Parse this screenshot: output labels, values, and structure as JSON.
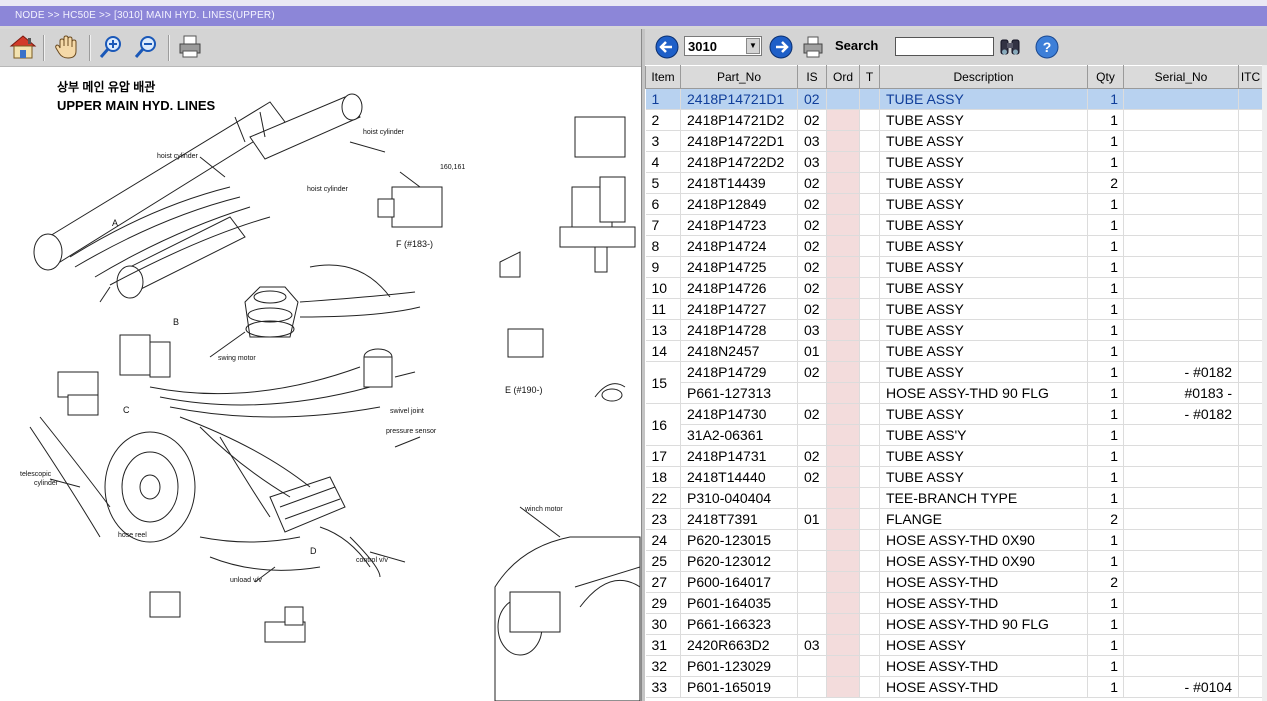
{
  "breadcrumb": "NODE >> HC50E >> [3010] MAIN HYD. LINES(UPPER)",
  "left_toolbar": {
    "icons": [
      "home-icon",
      "hand-icon",
      "zoom-in-icon",
      "zoom-out-icon",
      "print-icon"
    ]
  },
  "diagram": {
    "title_ko": "상부 메인 유압 배관",
    "title_en": "UPPER MAIN HYD. LINES",
    "labels": {
      "hoist_cyl_1": "hoist cylinder",
      "hoist_cyl_2": "hoist cylinder",
      "hoist_cyl_3": "hoist cylinder",
      "swing_motor": "swing motor",
      "swivel_joint": "swivel joint",
      "pressure_sensor": "pressure sensor",
      "telescopic": "telescopic",
      "cylinder": "cylinder",
      "hose_reel": "hose reel",
      "control_vv": "control v/v",
      "unload_vv": "unload v/v",
      "winch_motor": "winch motor",
      "f_detail": "F (#183-)",
      "e_detail": "E (#190-)",
      "f_num": "160,161",
      "a": "A",
      "b": "B",
      "c": "C",
      "d": "D"
    }
  },
  "right_toolbar": {
    "part_no": "3010",
    "search_label": "Search",
    "search_value": ""
  },
  "columns": [
    "Item",
    "Part_No",
    "IS",
    "Ord",
    "T",
    "Description",
    "Qty",
    "Serial_No",
    "ITC"
  ],
  "rows": [
    {
      "item": "1",
      "part": "2418P14721D1",
      "is": "02",
      "desc": "TUBE ASSY",
      "qty": "1",
      "serial": "",
      "sel": true
    },
    {
      "item": "2",
      "part": "2418P14721D2",
      "is": "02",
      "desc": "TUBE ASSY",
      "qty": "1",
      "serial": ""
    },
    {
      "item": "3",
      "part": "2418P14722D1",
      "is": "03",
      "desc": "TUBE ASSY",
      "qty": "1",
      "serial": ""
    },
    {
      "item": "4",
      "part": "2418P14722D2",
      "is": "03",
      "desc": "TUBE ASSY",
      "qty": "1",
      "serial": ""
    },
    {
      "item": "5",
      "part": "2418T14439",
      "is": "02",
      "desc": "TUBE ASSY",
      "qty": "2",
      "serial": ""
    },
    {
      "item": "6",
      "part": "2418P12849",
      "is": "02",
      "desc": "TUBE ASSY",
      "qty": "1",
      "serial": ""
    },
    {
      "item": "7",
      "part": "2418P14723",
      "is": "02",
      "desc": "TUBE ASSY",
      "qty": "1",
      "serial": ""
    },
    {
      "item": "8",
      "part": "2418P14724",
      "is": "02",
      "desc": "TUBE ASSY",
      "qty": "1",
      "serial": ""
    },
    {
      "item": "9",
      "part": "2418P14725",
      "is": "02",
      "desc": "TUBE ASSY",
      "qty": "1",
      "serial": ""
    },
    {
      "item": "10",
      "part": "2418P14726",
      "is": "02",
      "desc": "TUBE ASSY",
      "qty": "1",
      "serial": ""
    },
    {
      "item": "11",
      "part": "2418P14727",
      "is": "02",
      "desc": "TUBE ASSY",
      "qty": "1",
      "serial": ""
    },
    {
      "item": "13",
      "part": "2418P14728",
      "is": "03",
      "desc": "TUBE ASSY",
      "qty": "1",
      "serial": ""
    },
    {
      "item": "14",
      "part": "2418N2457",
      "is": "01",
      "desc": "TUBE ASSY",
      "qty": "1",
      "serial": ""
    },
    {
      "item": "15",
      "part": "2418P14729",
      "is": "02",
      "desc": "TUBE ASSY",
      "qty": "1",
      "serial": "-  #0182",
      "span": 2
    },
    {
      "item": "",
      "part": "P661-127313",
      "is": "",
      "desc": "HOSE ASSY-THD 90 FLG",
      "qty": "1",
      "serial": "#0183  -",
      "cont": true
    },
    {
      "item": "16",
      "part": "2418P14730",
      "is": "02",
      "desc": "TUBE ASSY",
      "qty": "1",
      "serial": "-  #0182",
      "span": 2
    },
    {
      "item": "",
      "part": "31A2-06361",
      "is": "",
      "desc": "TUBE ASS'Y",
      "qty": "1",
      "serial": "",
      "cont": true
    },
    {
      "item": "17",
      "part": "2418P14731",
      "is": "02",
      "desc": "TUBE ASSY",
      "qty": "1",
      "serial": ""
    },
    {
      "item": "18",
      "part": "2418T14440",
      "is": "02",
      "desc": "TUBE ASSY",
      "qty": "1",
      "serial": ""
    },
    {
      "item": "22",
      "part": "P310-040404",
      "is": "",
      "desc": "TEE-BRANCH TYPE",
      "qty": "1",
      "serial": ""
    },
    {
      "item": "23",
      "part": "2418T7391",
      "is": "01",
      "desc": "FLANGE",
      "qty": "2",
      "serial": ""
    },
    {
      "item": "24",
      "part": "P620-123015",
      "is": "",
      "desc": "HOSE ASSY-THD 0X90",
      "qty": "1",
      "serial": ""
    },
    {
      "item": "25",
      "part": "P620-123012",
      "is": "",
      "desc": "HOSE ASSY-THD 0X90",
      "qty": "1",
      "serial": ""
    },
    {
      "item": "27",
      "part": "P600-164017",
      "is": "",
      "desc": "HOSE ASSY-THD",
      "qty": "2",
      "serial": ""
    },
    {
      "item": "29",
      "part": "P601-164035",
      "is": "",
      "desc": "HOSE ASSY-THD",
      "qty": "1",
      "serial": ""
    },
    {
      "item": "30",
      "part": "P661-166323",
      "is": "",
      "desc": "HOSE ASSY-THD 90 FLG",
      "qty": "1",
      "serial": ""
    },
    {
      "item": "31",
      "part": "2420R663D2",
      "is": "03",
      "desc": "HOSE ASSY",
      "qty": "1",
      "serial": ""
    },
    {
      "item": "32",
      "part": "P601-123029",
      "is": "",
      "desc": "HOSE ASSY-THD",
      "qty": "1",
      "serial": ""
    },
    {
      "item": "33",
      "part": "P601-165019",
      "is": "",
      "desc": "HOSE ASSY-THD",
      "qty": "1",
      "serial": "-  #0104"
    }
  ],
  "colors": {
    "breadcrumb_bg": "#8c86d8",
    "selected_row": "#b8d2f0",
    "ord_col": "#f3dcdc",
    "toolbar": "#d4d4d4"
  }
}
